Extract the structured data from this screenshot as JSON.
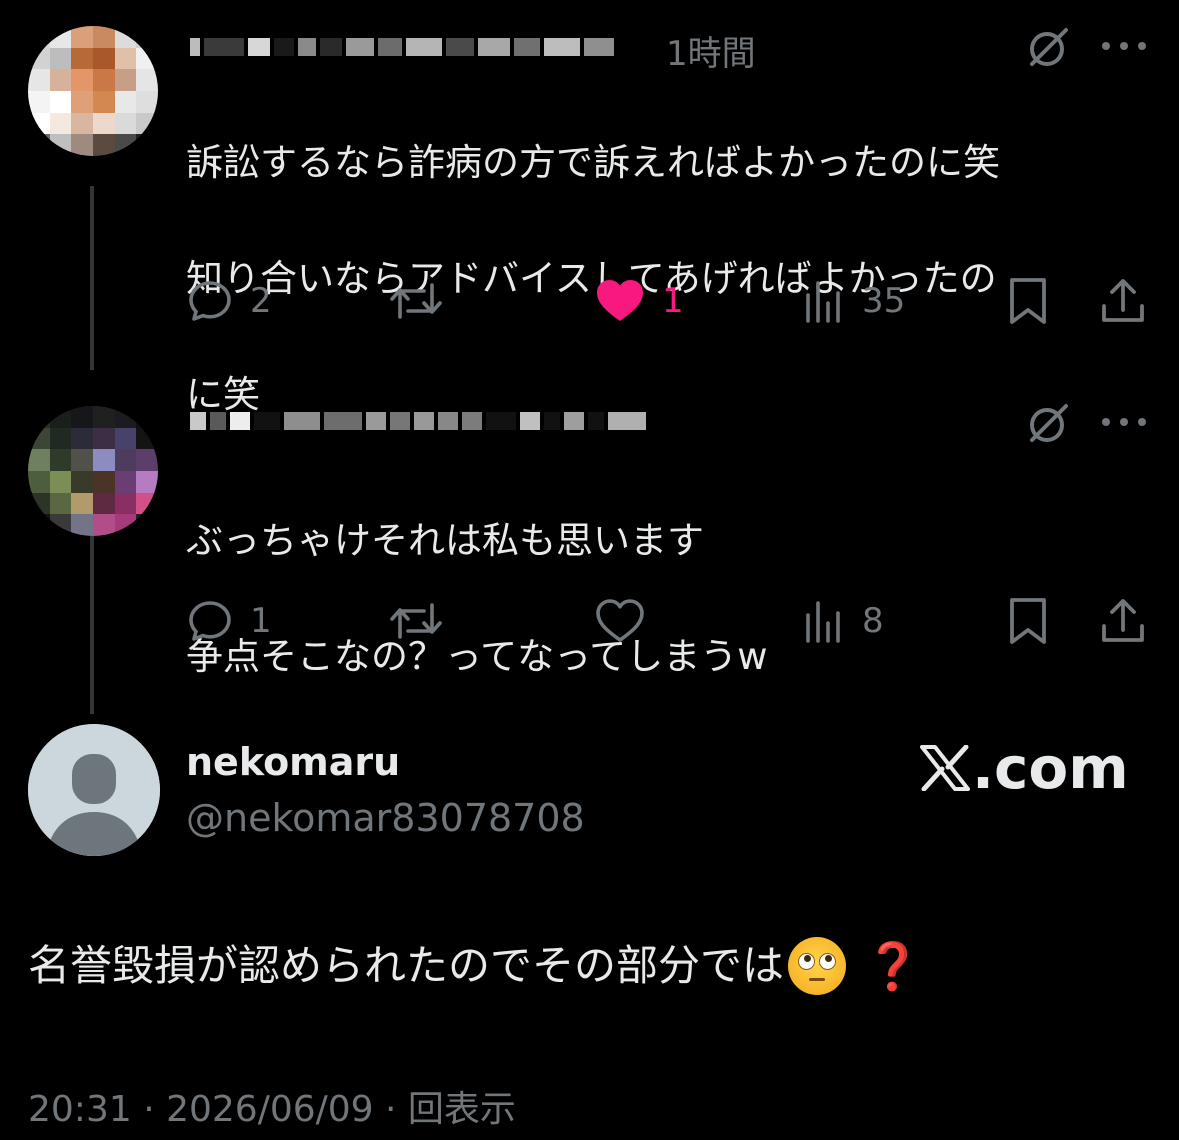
{
  "thread": {
    "replies": [
      {
        "time": "1時間",
        "lines": [
          "訴訟するなら詐病の方で訴えればよかったのに笑",
          "知り合いならアドバイスしてあげればよかったの",
          "に笑"
        ],
        "replies_count": "2",
        "likes_count": "1",
        "liked": true,
        "views_count": "35",
        "accent_like_color": "#f91880"
      },
      {
        "time": "",
        "lines": [
          "ぶっちゃけそれは私も思います",
          "争点そこなの？ってなってしまうw"
        ],
        "replies_count": "1",
        "likes_count": "",
        "liked": false,
        "views_count": "8"
      }
    ]
  },
  "main_post": {
    "display_name": "nekomaru",
    "handle": "@nekomar83078708",
    "brand": ".com",
    "text": "名誉毀損が認められたのでその部分では",
    "emoji_face": "face-with-rolling-eyes",
    "emoji_mark": "❓",
    "timestamp": "20:31 · 2026/06/09 · 回表示"
  },
  "colors": {
    "background": "#000000",
    "text_primary": "#e7e9ea",
    "text_secondary": "#71767b",
    "like": "#f91880"
  }
}
